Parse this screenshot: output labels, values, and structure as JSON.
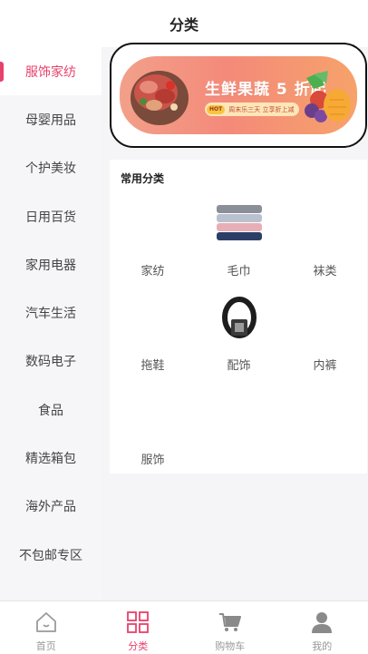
{
  "header": {
    "title": "分类"
  },
  "sidebar": {
    "items": [
      {
        "label": "服饰家纺",
        "active": true
      },
      {
        "label": "母婴用品"
      },
      {
        "label": "个护美妆"
      },
      {
        "label": "日用百货"
      },
      {
        "label": "家用电器"
      },
      {
        "label": "汽车生活"
      },
      {
        "label": "数码电子"
      },
      {
        "label": "食品"
      },
      {
        "label": "精选箱包"
      },
      {
        "label": "海外产品"
      },
      {
        "label": "不包邮专区"
      }
    ]
  },
  "banner": {
    "headline": "生鲜果蔬 5 折起",
    "badge": "HOT",
    "subtext": "周末乐三天 立享折上减"
  },
  "common": {
    "title": "常用分类",
    "items": [
      {
        "label": "家纺",
        "icon": ""
      },
      {
        "label": "毛巾",
        "icon": "towel-stack-image"
      },
      {
        "label": "袜类",
        "icon": ""
      },
      {
        "label": "拖鞋",
        "icon": ""
      },
      {
        "label": "配饰",
        "icon": "belt-image"
      },
      {
        "label": "内裤",
        "icon": ""
      },
      {
        "label": "服饰",
        "icon": ""
      }
    ]
  },
  "tabbar": {
    "items": [
      {
        "label": "首页",
        "icon": "home-icon"
      },
      {
        "label": "分类",
        "icon": "category-grid-icon",
        "active": true
      },
      {
        "label": "购物车",
        "icon": "cart-icon"
      },
      {
        "label": "我的",
        "icon": "user-icon"
      }
    ]
  },
  "colors": {
    "accent": "#e8416b",
    "inactive": "#999999"
  }
}
